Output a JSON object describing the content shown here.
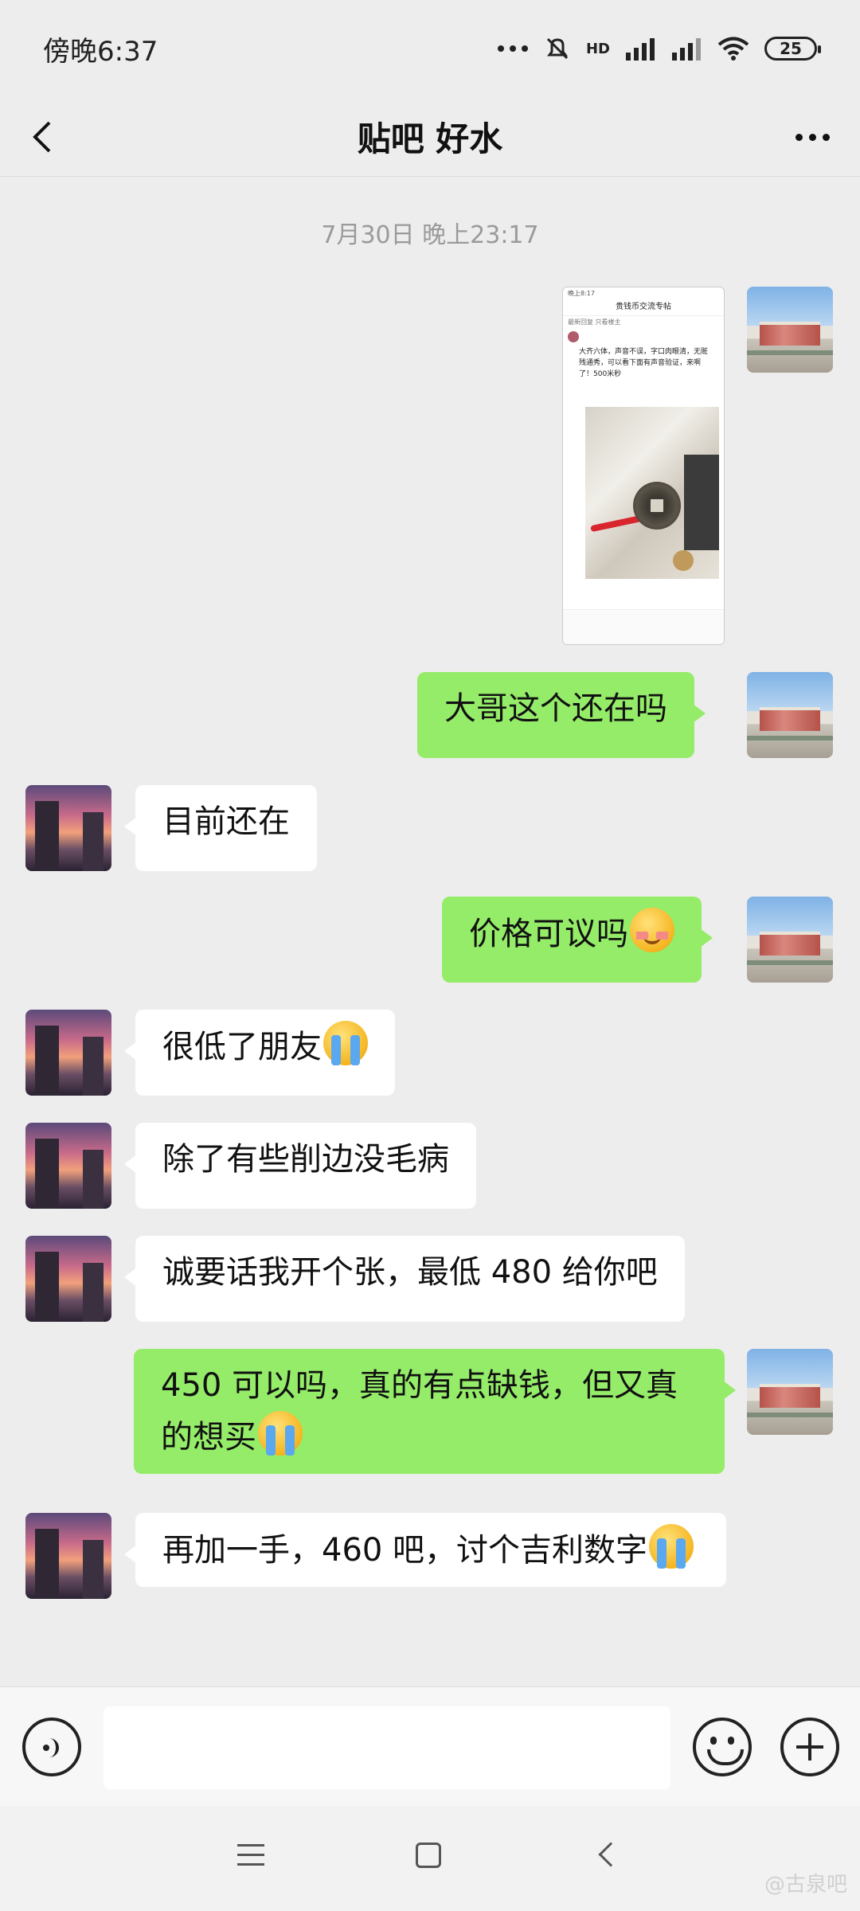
{
  "status_bar": {
    "time": "傍晚6:37",
    "signal_label": "HD",
    "battery": "25"
  },
  "header": {
    "title": "贴吧 好水"
  },
  "chat": {
    "timestamp": "7月30日 晚上23:17",
    "messages": [
      {
        "from": "me",
        "type": "image",
        "text": ""
      },
      {
        "from": "me",
        "type": "text",
        "text": "大哥这个还在吗"
      },
      {
        "from": "other",
        "type": "text",
        "text": "目前还在"
      },
      {
        "from": "me",
        "type": "text",
        "text": "价格可议吗",
        "emoji": "blush-emoji"
      },
      {
        "from": "other",
        "type": "text",
        "text": "很低了朋友",
        "emoji": "crying-emoji"
      },
      {
        "from": "other",
        "type": "text",
        "text": "除了有些削边没毛病"
      },
      {
        "from": "other",
        "type": "text",
        "text": "诚要话我开个张，最低 480 给你吧"
      },
      {
        "from": "me",
        "type": "text",
        "text": "450 可以吗，真的有点缺钱，但又真的想买",
        "emoji": "crying-emoji"
      },
      {
        "from": "other",
        "type": "text",
        "text": "再加一手，460 吧，讨个吉利数字",
        "emoji": "crying-emoji"
      }
    ]
  },
  "shared_screenshot": {
    "topbar": "晚上8:17",
    "title": "贵钱币交流专帖",
    "tabs": "最新回复  只看楼主",
    "body": "大齐六体，声音不误，字口肉眼清，无赃残通秀，可以看下面有声音验证，来啊了！500米秒"
  },
  "input_bar": {
    "placeholder": ""
  },
  "watermark": "@古泉吧"
}
